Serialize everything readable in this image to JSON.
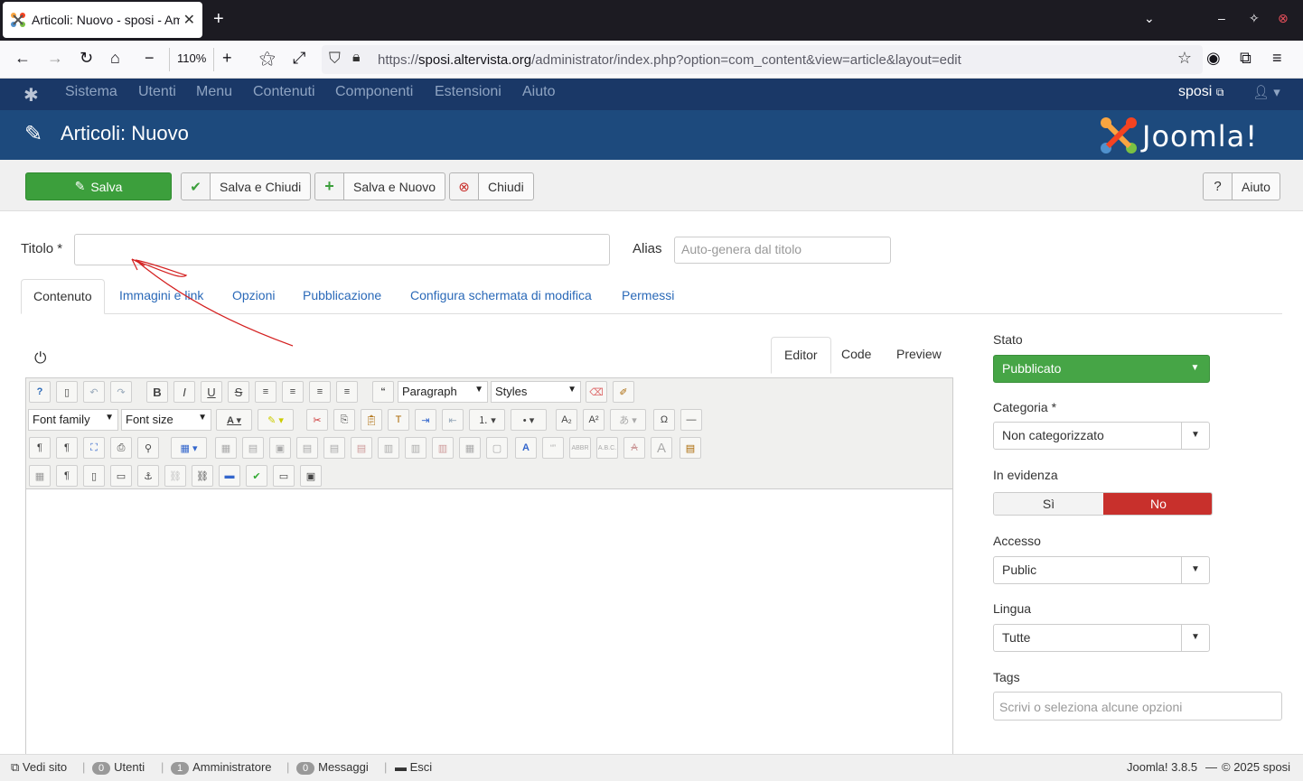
{
  "browser": {
    "tab_title": "Articoli: Nuovo - sposi - Am",
    "zoom": "110%",
    "url_prefix": "https://",
    "url_domain": "sposi.altervista.org",
    "url_path": "/administrator/index.php?option=com_content&view=article&layout=edit"
  },
  "menu": {
    "items": [
      "Sistema",
      "Utenti",
      "Menu",
      "Contenuti",
      "Componenti",
      "Estensioni",
      "Aiuto"
    ],
    "site_label": "sposi"
  },
  "header": {
    "title": "Articoli: Nuovo",
    "brand": "Joomla!"
  },
  "toolbar": {
    "save": "Salva",
    "save_close": "Salva e Chiudi",
    "save_new": "Salva e Nuovo",
    "close": "Chiudi",
    "help": "Aiuto"
  },
  "form": {
    "title_label": "Titolo *",
    "title_value": "",
    "alias_label": "Alias",
    "alias_placeholder": "Auto-genera dal titolo"
  },
  "tabs": [
    "Contenuto",
    "Immagini e link",
    "Opzioni",
    "Pubblicazione",
    "Configura schermata di modifica",
    "Permessi"
  ],
  "editor": {
    "tabs": [
      "Editor",
      "Code",
      "Preview"
    ],
    "format_select": "Paragraph",
    "styles_select": "Styles",
    "font_family": "Font family",
    "font_size": "Font size"
  },
  "sidebar": {
    "stato_label": "Stato",
    "stato_value": "Pubblicato",
    "categoria_label": "Categoria *",
    "categoria_value": "Non categorizzato",
    "evidenza_label": "In evidenza",
    "evidenza_si": "Sì",
    "evidenza_no": "No",
    "accesso_label": "Accesso",
    "accesso_value": "Public",
    "lingua_label": "Lingua",
    "lingua_value": "Tutte",
    "tags_label": "Tags",
    "tags_placeholder": "Scrivi o seleziona alcune opzioni"
  },
  "status": {
    "view_site": "Vedi sito",
    "users_count": "0",
    "users_label": "Utenti",
    "admin_count": "1",
    "admin_label": "Amministratore",
    "msg_count": "0",
    "msg_label": "Messaggi",
    "logout": "Esci",
    "version": "Joomla! 3.8.5",
    "copyright": "© 2025 sposi"
  },
  "colors": {
    "menu_bg": "#1a3867",
    "header_bg": "#1d4a7d",
    "save_green": "#3c9f3c",
    "no_red": "#c8302c",
    "annotation": "#d42020"
  }
}
